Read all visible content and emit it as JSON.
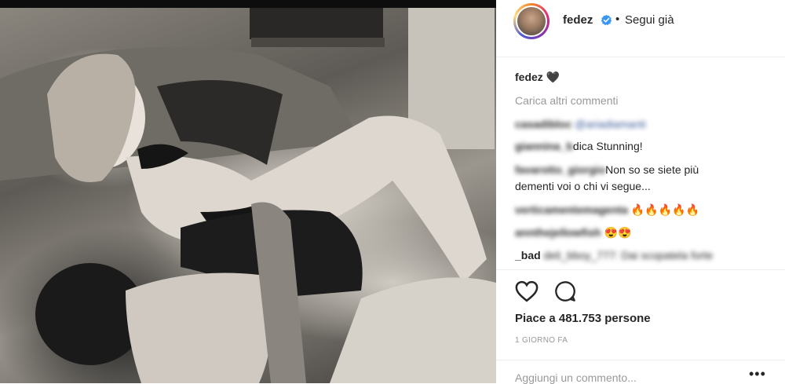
{
  "post": {
    "username": "fedez",
    "follow_status": "Segui già",
    "heart": "🖤",
    "load_more": "Carica altri commenti",
    "comments": [
      {
        "user": "casadibloc",
        "text": "@ariadiamanti",
        "blurred": true,
        "link": true
      },
      {
        "user": "giannina_b",
        "text": "dica Stunning!"
      },
      {
        "user": "favarotto_giorgio",
        "text": "Non so se siete più"
      },
      {
        "user": "",
        "text": "dementi voi o chi vi segue..."
      },
      {
        "user": "verticamentemagenta",
        "text": "🔥🔥🔥🔥🔥"
      },
      {
        "user": "annthejellowfish",
        "text": "😍😍"
      },
      {
        "user": "_bad",
        "text": "deli_bboy_777: Dai scopatela forte"
      }
    ],
    "likes": "Piace a 481.753 persone",
    "time": "1 GIORNO FA",
    "add_comment_placeholder": "Aggiungi un commento...",
    "more_options": "•••"
  },
  "colors": {
    "text": "#262626",
    "muted": "#999999",
    "verified": "#3897f0"
  }
}
